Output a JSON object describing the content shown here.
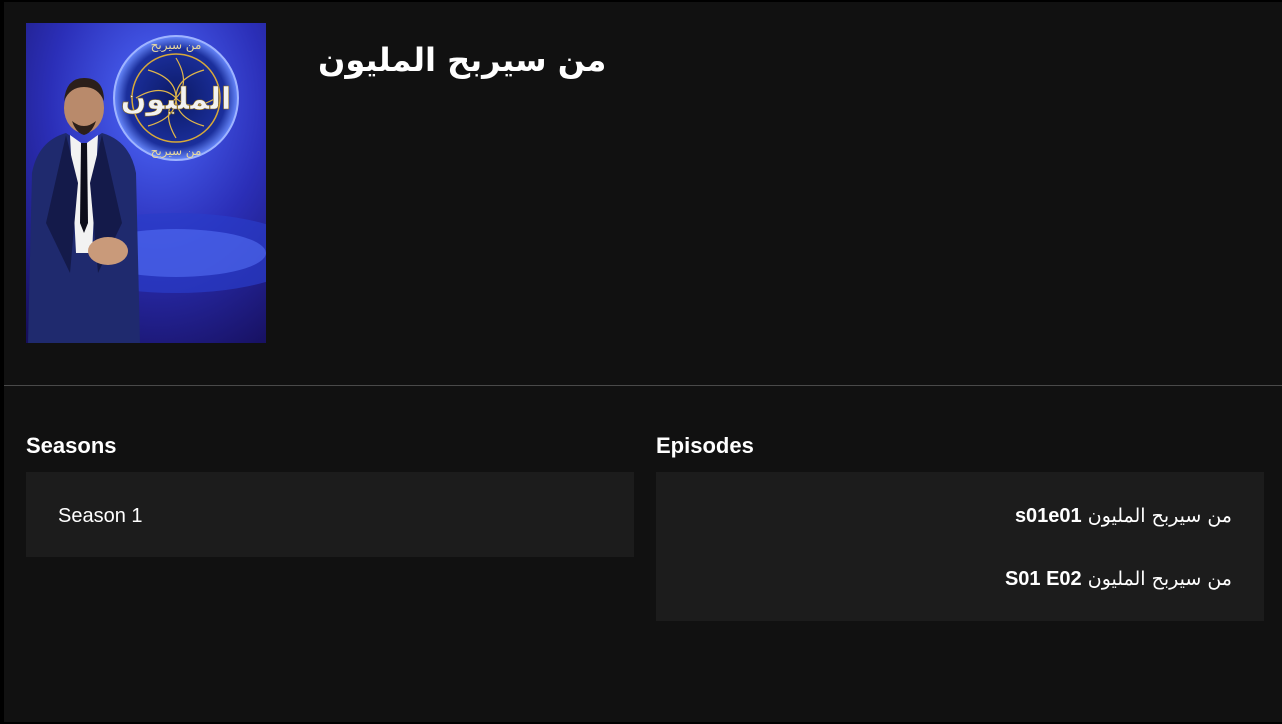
{
  "show": {
    "title": "من سيربح المليون",
    "poster": {
      "logo_text": "المليون",
      "logo_top_text": "من سيربح",
      "logo_bottom_text": "من سيربح"
    }
  },
  "seasons": {
    "heading": "Seasons",
    "items": [
      {
        "label": "Season 1"
      }
    ]
  },
  "episodes": {
    "heading": "Episodes",
    "items": [
      {
        "title": "من سيربح المليون",
        "code": "s01e01"
      },
      {
        "title": "من سيربح المليون",
        "code": "S01 E02"
      }
    ]
  },
  "colors": {
    "background": "#111111",
    "panel": "#1c1c1c",
    "divider": "#4a4a4a",
    "text": "#ffffff"
  }
}
